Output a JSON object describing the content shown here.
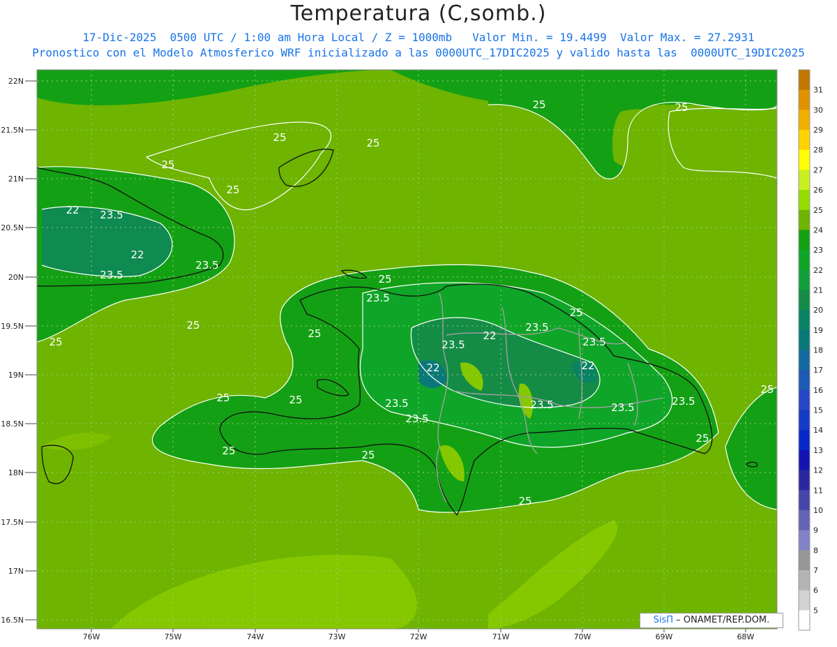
{
  "title": "Temperatura (C,somb.)",
  "subtitle_line1": "17-Dic-2025  0500 UTC / 1:00 am Hora Local / Z = 1000mb   Valor Min. = 19.4499  Valor Max. = 27.2931",
  "subtitle_line2": "Pronostico con el Modelo Atmosferico WRF inicializado a las 0000UTC_17DIC2025 y valido hasta las  0000UTC_19DIC2025",
  "credit": {
    "brand": "SisΠ",
    "text": "– ONAMET/REP.DOM."
  },
  "map": {
    "lat_labels": [
      "22N",
      "21.5N",
      "21N",
      "20.5N",
      "20N",
      "19.5N",
      "19N",
      "18.5N",
      "18N",
      "17.5N",
      "17N",
      "16.5N"
    ],
    "lon_labels": [
      "76W",
      "75W",
      "74W",
      "73W",
      "72W",
      "71W",
      "70W",
      "69W",
      "68W"
    ],
    "contour_labels": [
      "25",
      "25",
      "25",
      "25",
      "25",
      "25",
      "25",
      "25",
      "25",
      "25",
      "25",
      "25",
      "25",
      "25",
      "25",
      "25",
      "25",
      "25",
      "22",
      "23.5",
      "22",
      "23.5",
      "23.5",
      "23.5",
      "23.5",
      "22",
      "23.5",
      "22",
      "22",
      "23.5",
      "23.5",
      "23.5",
      "23.5",
      "23.5",
      "23.5"
    ]
  },
  "colorbar": {
    "labels": [
      "31",
      "30",
      "29",
      "28",
      "27",
      "26",
      "25",
      "24",
      "23",
      "22",
      "21",
      "20",
      "19",
      "18",
      "17",
      "16",
      "15",
      "14",
      "13",
      "12",
      "11",
      "10",
      "9",
      "8",
      "7",
      "6",
      "5"
    ],
    "colors": [
      "#c07800",
      "#e09200",
      "#f0b000",
      "#ffd200",
      "#ffff00",
      "#c8f020",
      "#96dc00",
      "#6eb400",
      "#14a014",
      "#0fa528",
      "#12a03c",
      "#148c46",
      "#0a8264",
      "#0a7878",
      "#146aa0",
      "#1e5ab4",
      "#2846c8",
      "#143cc8",
      "#0a28c8",
      "#1414b4",
      "#2828a0",
      "#4646aa",
      "#6464b4",
      "#8282c8",
      "#969696",
      "#b4b4b4",
      "#d2d2d2",
      "#ffffff"
    ]
  }
}
